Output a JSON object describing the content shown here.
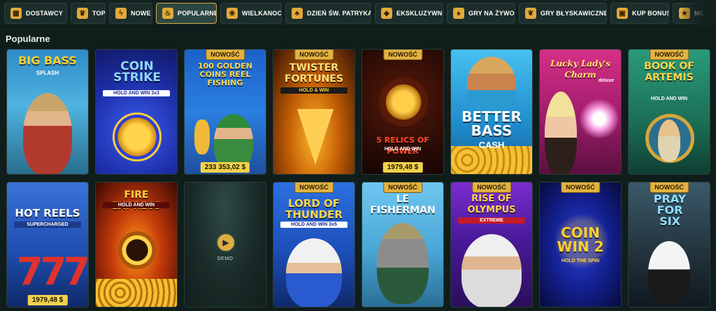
{
  "nav": {
    "items": [
      {
        "label": "DOSTAWCY",
        "icon": "providers-icon",
        "active": false
      },
      {
        "label": "TOP",
        "icon": "trophy-icon",
        "active": false
      },
      {
        "label": "NOWE",
        "icon": "lightning-icon",
        "active": false
      },
      {
        "label": "POPULARNE",
        "icon": "flame-icon",
        "active": true
      },
      {
        "label": "WIELKANOC",
        "icon": "easter-bunny-icon",
        "active": false
      },
      {
        "label": "DZIEŃ ŚW. PATRYKA",
        "icon": "hat-icon",
        "active": false
      },
      {
        "label": "EKSKLUZYWNE",
        "icon": "diamond-icon",
        "active": false
      },
      {
        "label": "GRY NA ŻYWO",
        "icon": "live-cards-icon",
        "active": false
      },
      {
        "label": "GRY BŁYSKAWICZNE",
        "icon": "cherries-icon",
        "active": false
      },
      {
        "label": "KUP BONUS",
        "icon": "chest-icon",
        "active": false
      },
      {
        "label": "ME",
        "icon": "more-icon",
        "active": false
      }
    ]
  },
  "section": {
    "title": "Popularne"
  },
  "badges": {
    "new": "NOWOŚĆ"
  },
  "demo": {
    "label": "DEMO"
  },
  "games": [
    {
      "title": "BIG BASS",
      "subtitle": "SPLASH",
      "new": false,
      "jackpot": ""
    },
    {
      "title": "COIN STRIKE",
      "subtitle": "HOLD AND WIN 3x3",
      "new": false,
      "jackpot": ""
    },
    {
      "title": "100 GOLDEN COINS REEL FISHING",
      "subtitle": "",
      "new": true,
      "jackpot": "233 353,02 $"
    },
    {
      "title": "TWISTER FORTUNES",
      "subtitle": "HOLD & WIN",
      "new": true,
      "jackpot": ""
    },
    {
      "title": "5 RELICS OF POWER",
      "subtitle": "HOLD AND WIN",
      "new": true,
      "jackpot": "1979,48 $"
    },
    {
      "title": "BETTER BASS",
      "subtitle": "CASH",
      "new": false,
      "jackpot": ""
    },
    {
      "title": "Lucky Lady's Charm",
      "subtitle": "deluxe",
      "new": false,
      "jackpot": ""
    },
    {
      "title": "BOOK OF ARTEMIS",
      "subtitle": "HOLD AND WIN",
      "new": true,
      "jackpot": ""
    },
    {
      "title": "HOT REELS",
      "subtitle": "SUPERCHARGED",
      "new": false,
      "jackpot": "1979,48 $"
    },
    {
      "title": "FIRE EXPRESS",
      "subtitle": "HOLD AND WIN",
      "new": false,
      "jackpot": ""
    },
    {
      "title": "",
      "subtitle": "",
      "new": false,
      "jackpot": ""
    },
    {
      "title": "LORD OF THUNDER",
      "subtitle": "HOLD AND WIN 3x5",
      "new": true,
      "jackpot": ""
    },
    {
      "title": "LE FISHERMAN",
      "subtitle": "",
      "new": true,
      "jackpot": ""
    },
    {
      "title": "RISE OF OLYMPUS",
      "subtitle": "EXTREME",
      "new": true,
      "jackpot": ""
    },
    {
      "title": "COIN WIN 2",
      "subtitle": "HOLD THE SPIN",
      "new": true,
      "jackpot": ""
    },
    {
      "title": "PRAY FOR SIX",
      "subtitle": "",
      "new": true,
      "jackpot": ""
    }
  ]
}
